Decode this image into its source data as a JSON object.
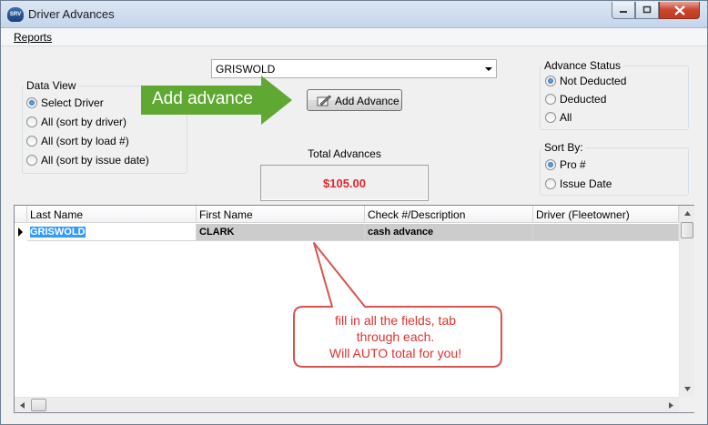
{
  "window": {
    "title": "Driver Advances",
    "app_icon_label": "SRV"
  },
  "menu": {
    "reports": "Reports"
  },
  "data_view": {
    "legend": "Data View",
    "options": [
      "Select Driver",
      "All (sort by driver)",
      "All (sort by load #)",
      "All (sort by issue date)"
    ],
    "selected": "Select Driver"
  },
  "driver_combo": {
    "value": "GRISWOLD"
  },
  "annotation_arrow": {
    "text": "Add advance",
    "color": "#5fa832"
  },
  "add_button": {
    "label": "Add Advance"
  },
  "totals": {
    "label": "Total Advances",
    "amount": "$105.00",
    "amount_color": "#e0282e"
  },
  "advance_status": {
    "legend": "Advance Status",
    "options": [
      "Not Deducted",
      "Deducted",
      "All"
    ],
    "selected": "Not Deducted"
  },
  "sort_by": {
    "legend": "Sort By:",
    "options": [
      "Pro #",
      "Issue Date"
    ],
    "selected": "Pro #"
  },
  "grid": {
    "columns": [
      "Last Name",
      "First Name",
      "Check #/Description",
      "Driver (Fleetowner)"
    ],
    "rows": [
      {
        "last_name": "GRISWOLD",
        "first_name": "CLARK",
        "description": "cash advance",
        "driver": ""
      }
    ]
  },
  "annotation_bubble": {
    "lines": [
      "fill in all the fields, tab",
      "through each.",
      "Will AUTO total for you!"
    ],
    "border_color": "#d9534f"
  }
}
